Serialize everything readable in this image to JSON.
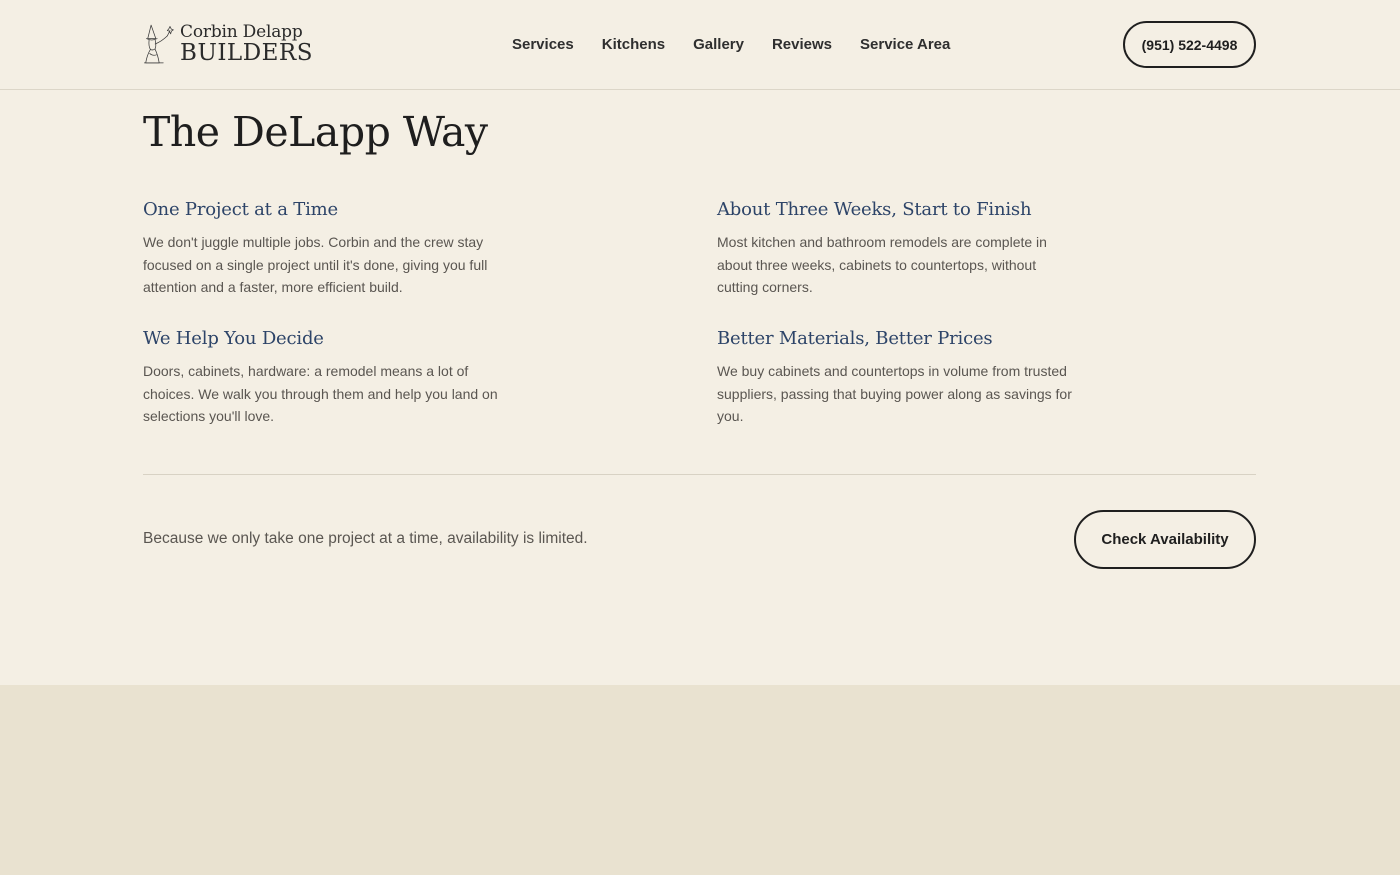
{
  "header": {
    "logo": {
      "line1": "Corbin Delapp",
      "line2": "BUILDERS",
      "icon": "wizard-icon"
    },
    "nav": [
      {
        "label": "Services"
      },
      {
        "label": "Kitchens"
      },
      {
        "label": "Gallery"
      },
      {
        "label": "Reviews"
      },
      {
        "label": "Service Area"
      }
    ],
    "phone": "(951) 522-4498"
  },
  "main": {
    "title": "The DeLapp Way",
    "features": [
      {
        "title": "One Project at a Time",
        "body": "We don't juggle multiple jobs. Corbin and the crew stay focused on a single project until it's done, giving you full attention and a faster, more efficient build."
      },
      {
        "title": "About Three Weeks, Start to Finish",
        "body": "Most kitchen and bathroom remodels are complete in about three weeks, cabinets to countertops, without cutting corners."
      },
      {
        "title": "We Help You Decide",
        "body": "Doors, cabinets, hardware: a remodel means a lot of choices. We walk you through them and help you land on selections you'll love."
      },
      {
        "title": "Better Materials, Better Prices",
        "body": "We buy cabinets and countertops in volume from trusted suppliers, passing that buying power along as savings for you."
      }
    ],
    "availability_note": "Because we only take one project at a time, availability is limited.",
    "cta_label": "Check Availability"
  },
  "colors": {
    "background": "#f4efe4",
    "accent_heading": "#2d4468",
    "lower_band": "#e9e2d0"
  }
}
